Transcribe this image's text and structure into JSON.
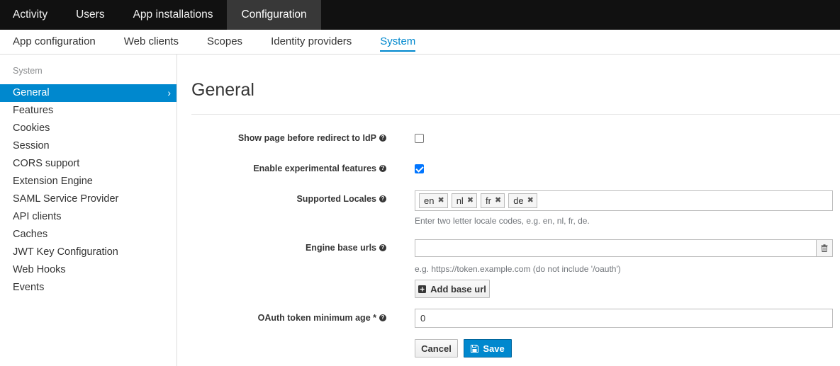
{
  "topnav": {
    "tabs": [
      "Activity",
      "Users",
      "App installations",
      "Configuration"
    ]
  },
  "subnav": {
    "tabs": [
      "App configuration",
      "Web clients",
      "Scopes",
      "Identity providers",
      "System"
    ]
  },
  "sidebar": {
    "section": "System",
    "items": [
      "General",
      "Features",
      "Cookies",
      "Session",
      "CORS support",
      "Extension Engine",
      "SAML Service Provider",
      "API clients",
      "Caches",
      "JWT Key Configuration",
      "Web Hooks",
      "Events"
    ]
  },
  "main": {
    "title": "General",
    "show_page_label": "Show page before redirect to IdP",
    "show_page_checked": false,
    "experimental_label": "Enable experimental features",
    "experimental_checked": true,
    "locales_label": "Supported Locales",
    "locales": [
      "en",
      "nl",
      "fr",
      "de"
    ],
    "locales_hint": "Enter two letter locale codes, e.g. en, nl, fr, de.",
    "engine_label": "Engine base urls",
    "engine_value": "",
    "engine_hint": "e.g. https://token.example.com (do not include '/oauth')",
    "add_base_url": "Add base url",
    "oauth_label": "OAuth token minimum age *",
    "oauth_value": "0",
    "cancel": "Cancel",
    "save": "Save"
  },
  "colors": {
    "accent": "#0088ce",
    "topnav_bg": "#111111",
    "active_tab_bg": "#383838"
  }
}
